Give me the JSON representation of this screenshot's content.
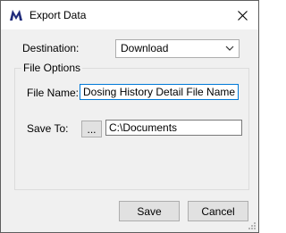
{
  "window": {
    "title": "Export Data",
    "icons": {
      "app": "app-logo-icon",
      "close": "close-icon"
    }
  },
  "destination": {
    "label": "Destination:",
    "selected": "Download"
  },
  "file_options": {
    "legend": "File Options",
    "file_name_label": "File Name:",
    "file_name_value": "Dosing History Detail File Name",
    "save_to_label": "Save To:",
    "browse_label": "...",
    "save_to_value": "C:\\Documents"
  },
  "buttons": {
    "save": "Save",
    "cancel": "Cancel"
  },
  "colors": {
    "accent": "#0078d7",
    "brand": "#1f2a7a"
  }
}
